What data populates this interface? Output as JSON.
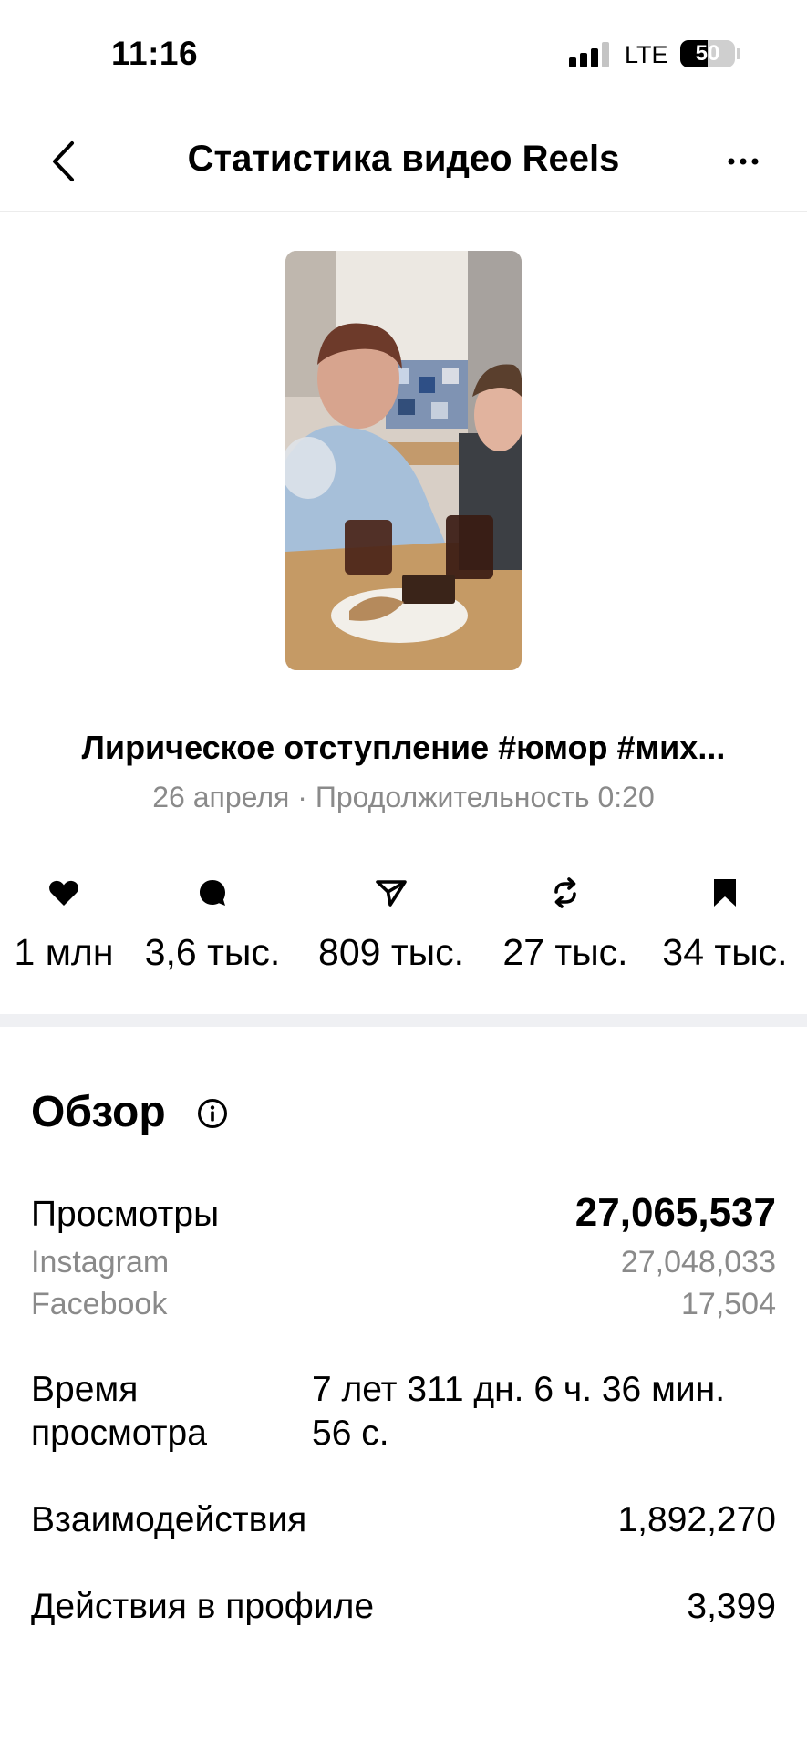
{
  "status_bar": {
    "time": "11:16",
    "network": "LTE",
    "battery": "50",
    "battery_level": 0.5
  },
  "header": {
    "title": "Статистика видео Reels"
  },
  "video": {
    "title": "Лирическое отступление #юмор #мих...",
    "meta": "26 апреля · Продолжительность 0:20"
  },
  "stats": [
    {
      "icon": "heart-icon",
      "value": "1 млн"
    },
    {
      "icon": "comment-icon",
      "value": "3,6 тыс."
    },
    {
      "icon": "share-icon",
      "value": "809 тыс."
    },
    {
      "icon": "repost-icon",
      "value": "27 тыс."
    },
    {
      "icon": "bookmark-icon",
      "value": "34 тыс."
    }
  ],
  "overview": {
    "title": "Обзор",
    "views": {
      "label": "Просмотры",
      "value": "27,065,537",
      "instagram_label": "Instagram",
      "instagram_value": "27,048,033",
      "facebook_label": "Facebook",
      "facebook_value": "17,504"
    },
    "watch_time": {
      "label_line1": "Время",
      "label_line2": "просмотра",
      "value_line1": "7 лет 311 дн. 6 ч. 36 мин.",
      "value_line2": "56 с."
    },
    "interactions": {
      "label": "Взаимодействия",
      "value": "1,892,270"
    },
    "profile_actions": {
      "label": "Действия в профиле",
      "value": "3,399"
    }
  }
}
